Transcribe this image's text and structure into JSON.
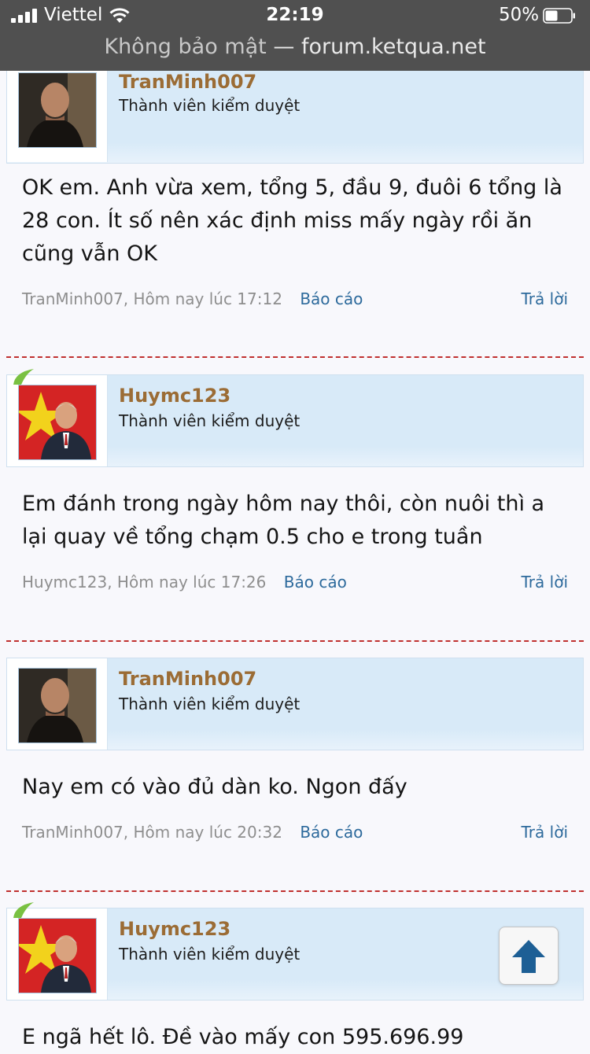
{
  "status_bar": {
    "carrier": "Viettel",
    "time": "22:19",
    "battery": "50%"
  },
  "address_bar": {
    "security": "Không bảo mật",
    "separator": "—",
    "domain": "forum.ketqua.net"
  },
  "colors": {
    "username": "#9b6c35",
    "link": "#2d6a9c",
    "header_bg": "#d8eaf8",
    "divider": "#c0302f",
    "topbar": "#505050"
  },
  "posts": [
    {
      "username": "TranMinh007",
      "user_title": "Thành viên kiểm duyệt",
      "avatar": "man-portrait-avatar",
      "message": "OK em. Anh vừa xem, tổng 5, đầu 9, đuôi 6 tổng là 28 con. Ít số nên xác định miss mấy ngày rồi ăn cũng vẫn OK",
      "meta": "TranMinh007, Hôm nay lúc 17:12",
      "report": "Báo cáo",
      "reply": "Trả lời"
    },
    {
      "username": "Huymc123",
      "user_title": "Thành viên kiểm duyệt",
      "avatar": "flag-coach-avatar",
      "message": "Em đánh trong ngày hôm nay thôi, còn nuôi thì a lại quay về tổng chạm 0.5 cho e trong tuần",
      "meta": "Huymc123, Hôm nay lúc 17:26",
      "report": "Báo cáo",
      "reply": "Trả lời"
    },
    {
      "username": "TranMinh007",
      "user_title": "Thành viên kiểm duyệt",
      "avatar": "man-portrait-avatar",
      "message": "Nay em có vào đủ dàn ko. Ngon đấy",
      "meta": "TranMinh007, Hôm nay lúc 20:32",
      "report": "Báo cáo",
      "reply": "Trả lời"
    },
    {
      "username": "Huymc123",
      "user_title": "Thành viên kiểm duyệt",
      "avatar": "flag-coach-avatar",
      "message": "E ngã hết lô. Đề vào mấy con 595.696.99"
    }
  ],
  "scroll_top": {
    "icon": "arrow-up-icon"
  }
}
